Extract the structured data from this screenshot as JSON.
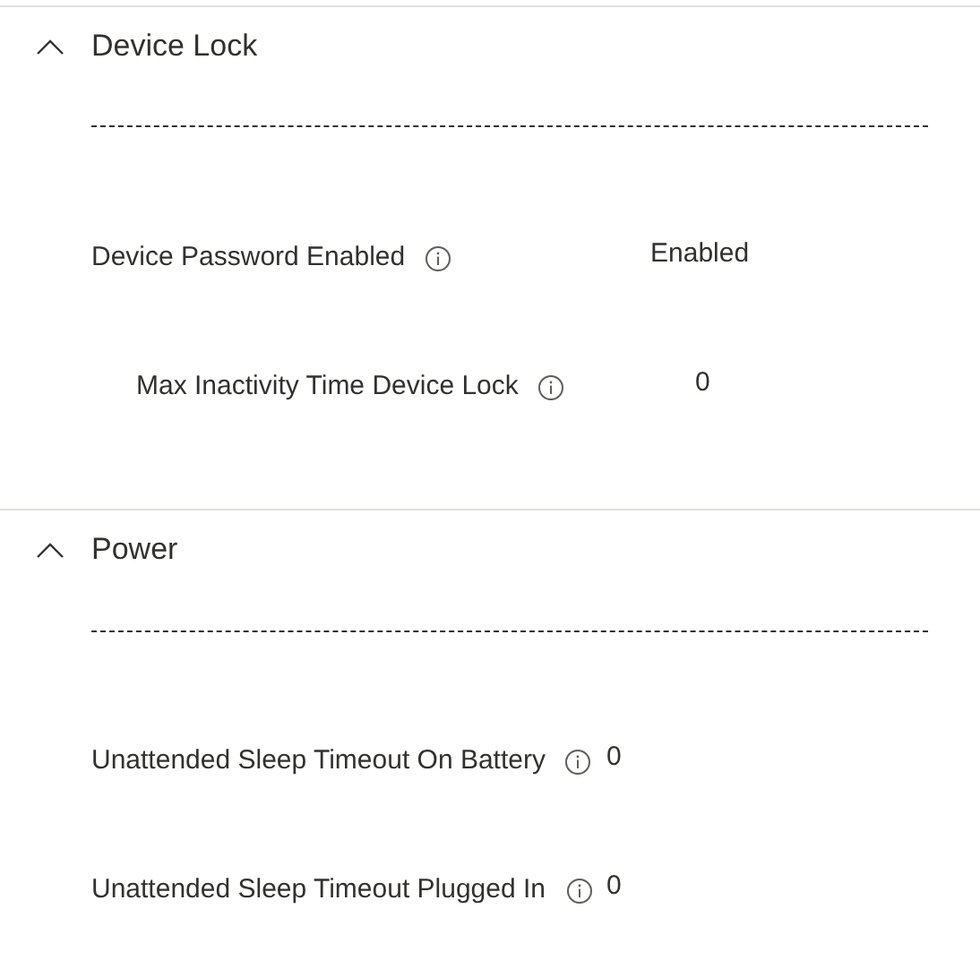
{
  "sections": [
    {
      "title": "Device Lock",
      "expanded": true,
      "settings": [
        {
          "label": "Device Password Enabled",
          "value": "Enabled",
          "kind": "aligned",
          "children": [
            {
              "label": "Max Inactivity Time Device Lock",
              "value": "0",
              "kind": "aligned"
            }
          ]
        }
      ]
    },
    {
      "title": "Power",
      "expanded": true,
      "settings": [
        {
          "label": "Unattended Sleep Timeout On Battery",
          "value": "0",
          "kind": "inline"
        },
        {
          "label": "Unattended Sleep Timeout Plugged In",
          "value": "0",
          "kind": "inline"
        }
      ]
    }
  ]
}
